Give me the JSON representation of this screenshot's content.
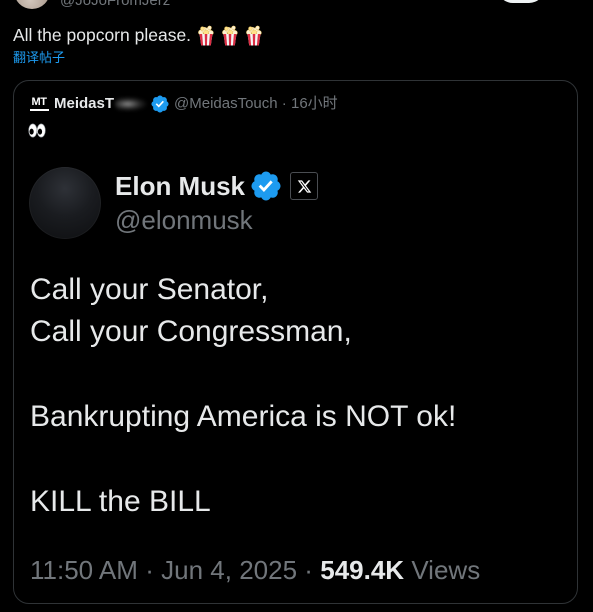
{
  "theme": {
    "background": "#000000",
    "text": "#e7e9ea",
    "muted": "#71767b",
    "link": "#1d9bf0",
    "border": "#2f3336",
    "verified": "#1d9bf0"
  },
  "post": {
    "author_handle": "@JoJoFromJerz",
    "text": "All the popcorn please.",
    "emojis": [
      "popcorn-icon",
      "popcorn-icon",
      "popcorn-icon"
    ],
    "translate_label": "翻译帖子"
  },
  "quote": {
    "logo_text": "MT",
    "author_name": "MeidasT",
    "verified_icon": "verified-badge-icon",
    "author_handle": "@MeidasTouch",
    "separator": "·",
    "time": "16小时",
    "emoji": "eyes-icon",
    "media": {
      "author_name": "Elon Musk",
      "verified_icon": "verified-badge-icon",
      "platform_icon": "x-logo-icon",
      "author_handle": "@elonmusk",
      "paragraphs": [
        [
          "Call your Senator,",
          "Call your Congressman,"
        ],
        [
          "Bankrupting America is NOT ok!"
        ],
        [
          "KILL the BILL"
        ]
      ],
      "time": "11:50 AM",
      "separator": "·",
      "date": "Jun 4, 2025",
      "views_count": "549.4K",
      "views_label": "Views"
    }
  }
}
